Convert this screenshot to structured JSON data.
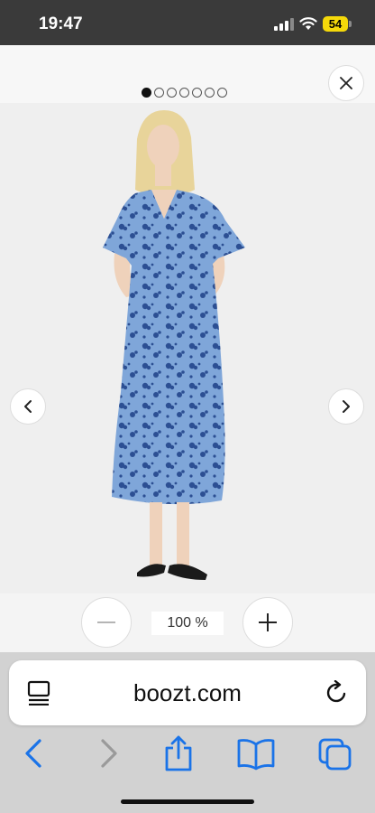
{
  "status_bar": {
    "time": "19:47",
    "battery_level": "54",
    "icons": [
      "signal-icon",
      "wifi-icon",
      "battery-icon"
    ]
  },
  "viewer": {
    "image_index": 1,
    "image_count": 7,
    "zoom_level": "100 %",
    "icons": [
      "close-icon",
      "chevron-left-icon",
      "chevron-right-icon",
      "minus-icon",
      "plus-icon"
    ],
    "colors": {
      "dress_base": "#7fa6d9",
      "dress_print": "#2c4f93",
      "skin": "#efd2bb",
      "hair": "#e8d49a"
    }
  },
  "browser": {
    "url": "boozt.com",
    "icons": [
      "reader-icon",
      "reload-icon",
      "back-icon",
      "forward-icon",
      "share-icon",
      "bookmarks-icon",
      "tabs-icon"
    ],
    "accent": "#1a73e8"
  }
}
